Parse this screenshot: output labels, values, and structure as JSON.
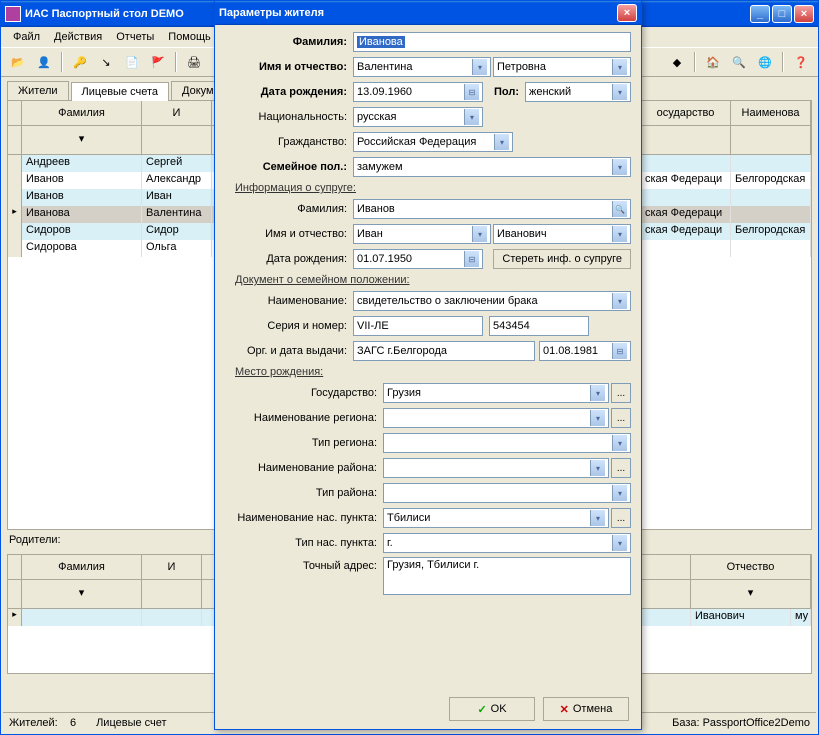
{
  "main": {
    "title": "ИАС Паспортный стол DEMO",
    "menu": [
      "Файл",
      "Действия",
      "Отчеты",
      "Помощь"
    ],
    "tabs": [
      "Жители",
      "Лицевые счета",
      "Документ"
    ],
    "active_tab": 1,
    "grid_headers": [
      "Фамилия",
      "И",
      "осударство",
      "Наименова"
    ],
    "rows": [
      {
        "f": "Андреев",
        "n": "Сергей",
        "g": "",
        "r": ""
      },
      {
        "f": "Иванов",
        "n": "Александр",
        "g": "ская Федераци",
        "r": "Белгородская"
      },
      {
        "f": "Иванов",
        "n": "Иван",
        "g": "",
        "r": ""
      },
      {
        "f": "Иванова",
        "n": "Валентина",
        "g": "ская Федераци",
        "r": ""
      },
      {
        "f": "Сидоров",
        "n": "Сидор",
        "g": "ская Федераци",
        "r": "Белгородская"
      },
      {
        "f": "Сидорова",
        "n": "Ольга",
        "g": "",
        "r": ""
      }
    ],
    "parents_label": "Родители:",
    "parent_headers": [
      "Фамилия",
      "И",
      "Отчество"
    ],
    "parent_row": {
      "o": "Иванович",
      "m": "му"
    },
    "status": {
      "s1_label": "Жителей:",
      "s1_val": "6",
      "s2": "Лицевые счет",
      "s3": "База: PassportOffice2Demo"
    }
  },
  "dialog": {
    "title": "Параметры жителя",
    "labels": {
      "surname": "Фамилия:",
      "name_patr": "Имя и отчество:",
      "birth": "Дата рождения:",
      "sex": "Пол:",
      "nat": "Национальность:",
      "cit": "Гражданство:",
      "marital": "Семейное пол.:",
      "spouse_info": "Информация о супруге:",
      "sp_surname": "Фамилия:",
      "sp_name": "Имя и отчество:",
      "sp_birth": "Дата рождения:",
      "erase_spouse": "Стереть инф. о супруге",
      "doc_group": "Документ о семейном положении:",
      "doc_name": "Наименование:",
      "doc_series": "Серия и номер:",
      "doc_issued": "Орг. и дата выдачи:",
      "birthplace": "Место рождения:",
      "state": "Государство:",
      "region_name": "Наименование региона:",
      "region_type": "Тип региона:",
      "district_name": "Наименование района:",
      "district_type": "Тип района:",
      "locality_name": "Наименование нас. пункта:",
      "locality_type": "Тип нас. пункта:",
      "exact_addr": "Точный адрес:"
    },
    "values": {
      "surname": "Иванова",
      "name": "Валентина",
      "patronymic": "Петровна",
      "birth": "13.09.1960",
      "sex": "женский",
      "nat": "русская",
      "cit": "Российская Федерация",
      "marital": "замужем",
      "sp_surname": "Иванов",
      "sp_name": "Иван",
      "sp_patr": "Иванович",
      "sp_birth": "01.07.1950",
      "doc_name": "свидетельство о заключении брака",
      "doc_series": "VII-ЛЕ",
      "doc_number": "543454",
      "doc_org": "ЗАГС г.Белгорода",
      "doc_date": "01.08.1981",
      "state": "Грузия",
      "region_name": "",
      "region_type": "",
      "district_name": "",
      "district_type": "",
      "locality_name": "Тбилиси",
      "locality_type": "г.",
      "exact_addr": "Грузия, Тбилиси г."
    },
    "buttons": {
      "ok": "OK",
      "cancel": "Отмена"
    }
  }
}
